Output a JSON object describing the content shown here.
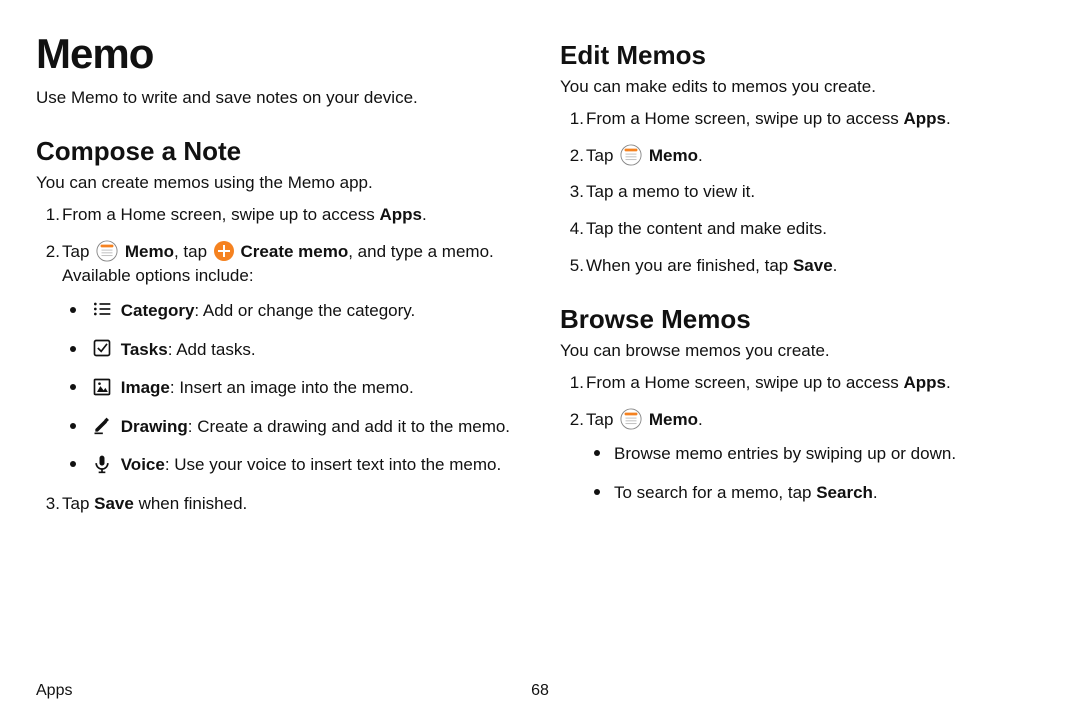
{
  "page_title": "Memo",
  "intro": "Use Memo to write and save notes on your device.",
  "compose": {
    "heading": "Compose a Note",
    "sub": "You can create memos using the Memo app.",
    "step1_pre": "From a Home screen, swipe up to access ",
    "step1_bold": "Apps",
    "step1_post": ".",
    "step2_a": "Tap ",
    "step2_memo": " Memo",
    "step2_b": ", tap ",
    "step2_create": " Create memo",
    "step2_c": ", and type a memo. Available options include:",
    "opt_category_bold": "Category",
    "opt_category_rest": ": Add or change the category.",
    "opt_tasks_bold": "Tasks",
    "opt_tasks_rest": ": Add tasks.",
    "opt_image_bold": "Image",
    "opt_image_rest": ": Insert an image into the memo.",
    "opt_drawing_bold": "Drawing",
    "opt_drawing_rest": ": Create a drawing and add it to the memo.",
    "opt_voice_bold": "Voice",
    "opt_voice_rest": ": Use your voice to insert text into the memo.",
    "step3_a": "Tap ",
    "step3_bold": "Save",
    "step3_b": " when finished."
  },
  "edit": {
    "heading": "Edit Memos",
    "sub": "You can make edits to memos you create.",
    "s1_pre": "From a Home screen, swipe up to access ",
    "s1_bold": "Apps",
    "s1_post": ".",
    "s2_a": "Tap ",
    "s2_memo": " Memo",
    "s2_b": ".",
    "s3": "Tap a memo to view it.",
    "s4": "Tap the content and make edits.",
    "s5_a": "When you are finished, tap ",
    "s5_bold": "Save",
    "s5_b": "."
  },
  "browse": {
    "heading": "Browse Memos",
    "sub": "You can browse memos you create.",
    "s1_pre": "From a Home screen, swipe up to access ",
    "s1_bold": "Apps",
    "s1_post": ".",
    "s2_a": "Tap ",
    "s2_memo": " Memo",
    "s2_b": ".",
    "b1": "Browse memo entries by swiping up or down.",
    "b2_a": "To search for a memo, tap ",
    "b2_bold": "Search",
    "b2_b": "."
  },
  "footer": {
    "section": "Apps",
    "page": "68"
  }
}
